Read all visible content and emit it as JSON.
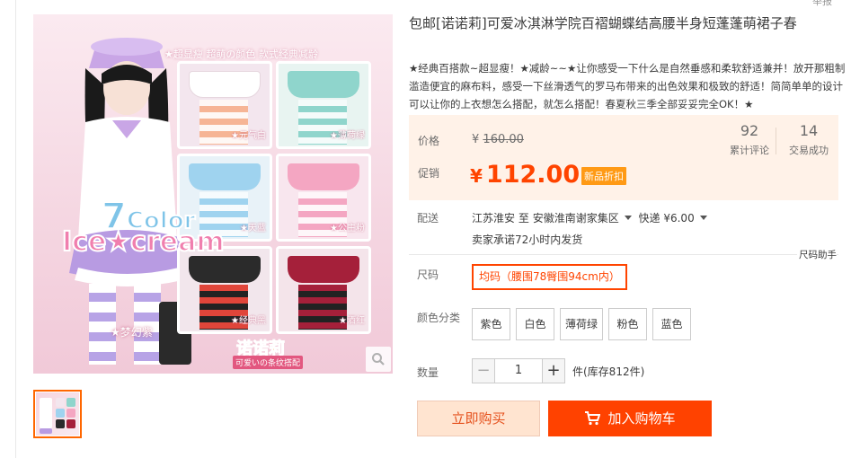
{
  "gallery": {
    "image_texts": {
      "headline": "★超显瘦 超萌の颜色 款式经典减龄",
      "big_number": "7",
      "big_word": "Color",
      "ice_cream": "Ice★cream",
      "dream_purple": "★梦幻紫",
      "brand_logo": "诺诺莉",
      "brand_sub": "可爱いの条纹搭配",
      "panels": [
        "★元气白",
        "★薄荷绿",
        "★天蓝",
        "★公主粉",
        "★经典黑",
        "★酒红"
      ]
    },
    "zoom_icon": "magnifier-icon",
    "colors": {
      "panel_white": "#f6eef2",
      "panel_mint": "#8fd5cc",
      "panel_sky": "#9fd3ef",
      "panel_pink": "#f4a6c2",
      "panel_black": "#2b2b2b",
      "panel_wine": "#a5203a",
      "purple": "#b89be2",
      "stripe_red": "#e0453a"
    }
  },
  "product": {
    "title": "包邮[诺诺莉]可爱冰淇淋学院百褶蝴蝶结高腰半身短蓬蓬萌裙子春",
    "subtitle": "★经典百搭款~超显瘦！★减龄~~★让你感受一下什么是自然垂感和柔软舒适兼并！放开那粗制滥造便宜的麻布料，感受一下丝滑透气的罗马布带来的出色效果和极致的舒适！简简单单的设计可以让你的上衣想怎么搭配，就怎么搭配！春夏秋三季全部妥妥完全OK！★",
    "corner_text": "举报"
  },
  "price": {
    "price_label": "价格",
    "original_currency": "¥",
    "original_value": "160.00",
    "promo_label": "促销",
    "promo_currency": "¥",
    "promo_value": "112.00",
    "promo_tag": "新品折扣",
    "reviews_count": "92",
    "reviews_label": "累计评论",
    "sales_count": "14",
    "sales_label": "交易成功"
  },
  "shipping": {
    "label": "配送",
    "from": "江苏淮安",
    "to_word": "至",
    "destination": "安徽淮南谢家集区",
    "method": "快递 ¥6.00",
    "promise": "卖家承诺72小时内发货"
  },
  "size": {
    "label": "尺码",
    "help": "尺码助手",
    "selected": "均码（腰围78臀围94cm内）"
  },
  "color_category": {
    "label": "颜色分类",
    "options": [
      "紫色",
      "白色",
      "薄荷绿",
      "粉色",
      "蓝色"
    ]
  },
  "quantity": {
    "label": "数量",
    "minus": "−",
    "value": "1",
    "plus": "+",
    "stock": "件(库存812件)"
  },
  "actions": {
    "buy_now": "立即购买",
    "add_to_cart": "加入购物车"
  }
}
